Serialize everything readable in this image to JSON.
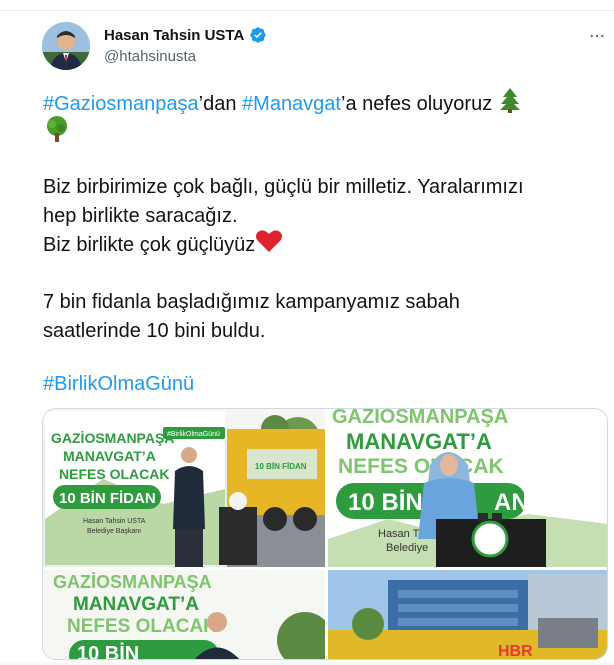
{
  "author": {
    "name": "Hasan Tahsin USTA",
    "handle": "@htahsinusta"
  },
  "tweet": {
    "line1": {
      "hashtag1": "#Gaziosmanpaşa",
      "text1": "’dan ",
      "hashtag2": "#Manavgat",
      "text2": "’a nefes oluyoruz"
    },
    "para1_line1": "Biz birbirimize çok bağlı, güçlü bir milletiz. Yaralarımızı",
    "para1_line2": "hep birlikte saracağız.",
    "para1_line3": "Biz birlikte çok güçlüyüz",
    "para2_line1": "7 bin fidanla başladığımız kampanyamız sabah",
    "para2_line2": "saatlerinde 10 bini buldu.",
    "hashtag": "#BirlikOlmaGünü"
  },
  "media": {
    "photo1": {
      "banner_title1": "GAZİOSMANPAŞA",
      "banner_title2": "MANAVGAT’A",
      "banner_title3": "NEFES OLACAK",
      "banner_pill": "10 BİN FİDAN",
      "banner_sign1": "Hasan Tahsin USTA",
      "banner_sign2": "Belediye Başkanı",
      "tag": "#BirlikOlmaGünü",
      "truck_sign": "10 BİN FİDAN"
    },
    "photo2": {
      "title1": "GAZİOSMANPAŞA",
      "title2": "MANAVGAT’A",
      "title3": "NEFES OLACAK",
      "pill": "10 BİN",
      "pill_end": "AN",
      "sign1": "Hasan Tah",
      "sign2": "Belediye"
    },
    "photo3": {
      "title1": "GAZİOSMANPAŞA",
      "title2": "MANAVGAT’A",
      "title3": "NEFES OLACAK",
      "pill": "10 BİN"
    },
    "photo4": {
      "watermark": "HBR"
    }
  },
  "colors": {
    "hashtag": "#1d9bf0",
    "banner_green": "#2e9b3e",
    "text": "#0f1419",
    "muted": "#536471"
  },
  "icons": [
    "verified-badge-icon",
    "more-options-icon",
    "evergreen-tree-emoji",
    "deciduous-tree-emoji",
    "red-heart-emoji"
  ]
}
